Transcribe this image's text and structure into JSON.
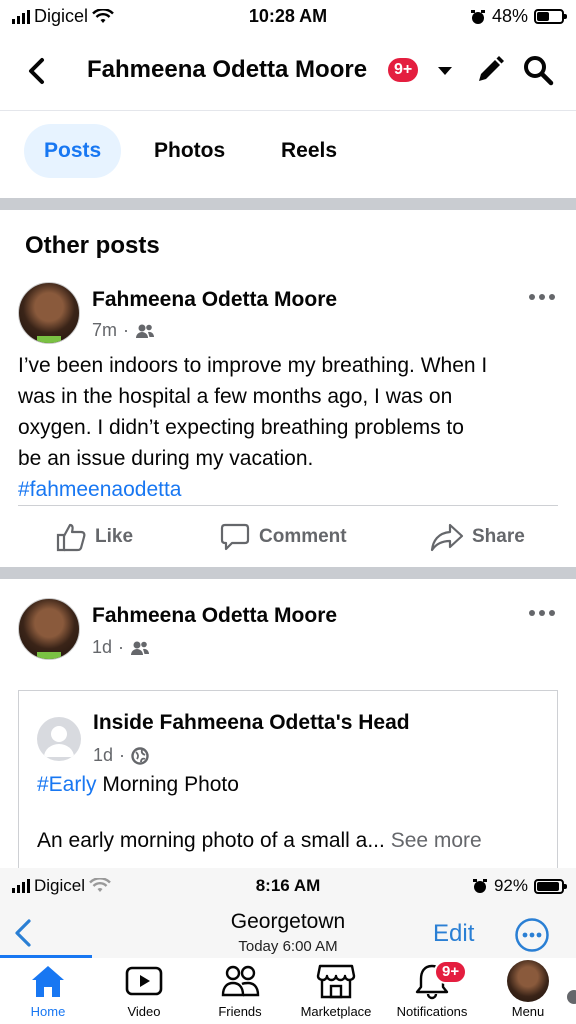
{
  "status_bar": {
    "carrier": "Digicel",
    "time": "10:28 AM",
    "battery": "48%",
    "battery_level": 0.48
  },
  "header": {
    "title": "Fahmeena Odetta Moore",
    "badge": "9+"
  },
  "tabs": [
    {
      "label": "Posts",
      "active": true
    },
    {
      "label": "Photos"
    },
    {
      "label": "Reels"
    }
  ],
  "section_title": "Other posts",
  "post1": {
    "author": "Fahmeena Odetta Moore",
    "time": "7m",
    "audience_icon": "friends-icon",
    "lines": [
      "I’ve been indoors to improve my breathing. When I",
      "was in the hospital a few months ago, I was on",
      "oxygen. I didn’t expecting breathing problems to",
      "be an issue during my vacation."
    ],
    "hashtag": "#fahmeenaodetta",
    "actions": {
      "like": "Like",
      "comment": "Comment",
      "share": "Share"
    }
  },
  "post2": {
    "author": "Fahmeena Odetta Moore",
    "time": "1d",
    "audience_icon": "friends-icon",
    "shared": {
      "title": "Inside Fahmeena Odetta's Head",
      "time": "1d",
      "audience_icon": "globe-icon",
      "hashtag": "#Early",
      "line1_rest": " Morning Photo",
      "line2": "An early morning photo of a small a...",
      "see_more": "See more"
    }
  },
  "overlay": {
    "carrier": "Digicel",
    "time": "8:16 AM",
    "battery": "92%",
    "battery_level": 0.92,
    "city": "Georgetown",
    "sub": "Today  6:00 AM",
    "edit": "Edit"
  },
  "bottom_nav": [
    {
      "label": "Home",
      "icon": "home-icon",
      "active": true
    },
    {
      "label": "Video",
      "icon": "video-icon"
    },
    {
      "label": "Friends",
      "icon": "friends-icon"
    },
    {
      "label": "Marketplace",
      "icon": "marketplace-icon"
    },
    {
      "label": "Notifications",
      "icon": "bell-icon",
      "badge": "9+"
    },
    {
      "label": "Menu",
      "icon": "menu-avatar-icon"
    }
  ],
  "colors": {
    "accent": "#1877f2",
    "badge": "#e41e3f",
    "separator": "#c9ccd1"
  }
}
